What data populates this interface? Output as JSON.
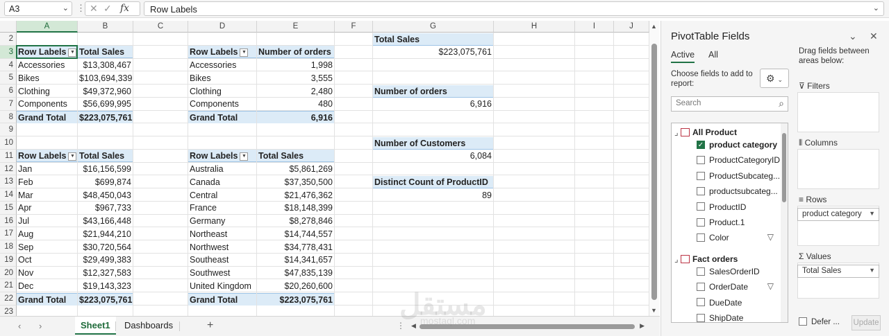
{
  "formula_bar": {
    "name_box": "A3",
    "formula": "Row Labels",
    "cancel_icon": "✕",
    "enter_icon": "✓",
    "fx_label": "fx"
  },
  "columns": [
    "A",
    "B",
    "C",
    "D",
    "E",
    "F",
    "G",
    "H",
    "I",
    "J"
  ],
  "rows": [
    "2",
    "3",
    "4",
    "5",
    "6",
    "7",
    "8",
    "9",
    "10",
    "11",
    "12",
    "13",
    "14",
    "15",
    "16",
    "17",
    "18",
    "19",
    "20",
    "21",
    "22",
    "23"
  ],
  "pivot1": {
    "header": [
      "Row Labels",
      "Total Sales"
    ],
    "rows": [
      [
        "Accessories",
        "$13,308,467"
      ],
      [
        "Bikes",
        "$103,694,339"
      ],
      [
        "Clothing",
        "$49,372,960"
      ],
      [
        "Components",
        "$56,699,995"
      ]
    ],
    "total": [
      "Grand Total",
      "$223,075,761"
    ]
  },
  "pivot2": {
    "header": [
      "Row Labels",
      "Number of orders"
    ],
    "rows": [
      [
        "Accessories",
        "1,998"
      ],
      [
        "Bikes",
        "3,555"
      ],
      [
        "Clothing",
        "2,480"
      ],
      [
        "Components",
        "480"
      ]
    ],
    "total": [
      "Grand Total",
      "6,916"
    ]
  },
  "pivot3": {
    "header": [
      "Row Labels",
      "Total Sales"
    ],
    "rows": [
      [
        "Jan",
        "$16,156,599"
      ],
      [
        "Feb",
        "$699,874"
      ],
      [
        "Mar",
        "$48,450,043"
      ],
      [
        "Apr",
        "$967,733"
      ],
      [
        "Jul",
        "$43,166,448"
      ],
      [
        "Aug",
        "$21,944,210"
      ],
      [
        "Sep",
        "$30,720,564"
      ],
      [
        "Oct",
        "$29,499,383"
      ],
      [
        "Nov",
        "$12,327,583"
      ],
      [
        "Dec",
        "$19,143,323"
      ]
    ],
    "total": [
      "Grand Total",
      "$223,075,761"
    ]
  },
  "pivot4": {
    "header": [
      "Row Labels",
      "Total Sales"
    ],
    "rows": [
      [
        "Australia",
        "$5,861,269"
      ],
      [
        "Canada",
        "$37,350,500"
      ],
      [
        "Central",
        "$21,476,362"
      ],
      [
        "France",
        "$18,148,399"
      ],
      [
        "Germany",
        "$8,278,846"
      ],
      [
        "Northeast",
        "$14,744,557"
      ],
      [
        "Northwest",
        "$34,778,431"
      ],
      [
        "Southeast",
        "$14,341,657"
      ],
      [
        "Southwest",
        "$47,835,139"
      ],
      [
        "United Kingdom",
        "$20,260,600"
      ]
    ],
    "total": [
      "Grand Total",
      "$223,075,761"
    ]
  },
  "kpis": [
    {
      "label": "Total Sales",
      "value": "$223,075,761"
    },
    {
      "label": "Number of orders",
      "value": "6,916"
    },
    {
      "label": "Number of Customers",
      "value": "6,084"
    },
    {
      "label": "Distinct Count of ProductID",
      "value": "89"
    }
  ],
  "sheet_tabs": {
    "tabs": [
      "Sheet1",
      "Dashboards"
    ],
    "active": "Sheet1",
    "add": "+"
  },
  "pane": {
    "title": "PivotTable Fields",
    "tabs": [
      "Active",
      "All"
    ],
    "choose_text": "Choose fields to add to report:",
    "drag_text": "Drag fields between areas below:",
    "search_placeholder": "Search",
    "tables": [
      {
        "name": "All Product",
        "fields": [
          {
            "name": "product category",
            "checked": true
          },
          {
            "name": "ProductCategoryID",
            "checked": false
          },
          {
            "name": "ProductSubcateg...",
            "checked": false
          },
          {
            "name": "productsubcateg...",
            "checked": false
          },
          {
            "name": "ProductID",
            "checked": false
          },
          {
            "name": "Product.1",
            "checked": false
          },
          {
            "name": "Color",
            "checked": false
          }
        ]
      },
      {
        "name": "Fact orders",
        "fields": [
          {
            "name": "SalesOrderID",
            "checked": false
          },
          {
            "name": "OrderDate",
            "checked": false
          },
          {
            "name": "DueDate",
            "checked": false
          },
          {
            "name": "ShipDate",
            "checked": false
          }
        ]
      }
    ],
    "areas": {
      "filters": "Filters",
      "columns": "Columns",
      "rows": "Rows",
      "values": "Values"
    },
    "rows_field": "product category",
    "values_field": "Total Sales",
    "defer_label": "Defer ...",
    "update_label": "Update"
  }
}
